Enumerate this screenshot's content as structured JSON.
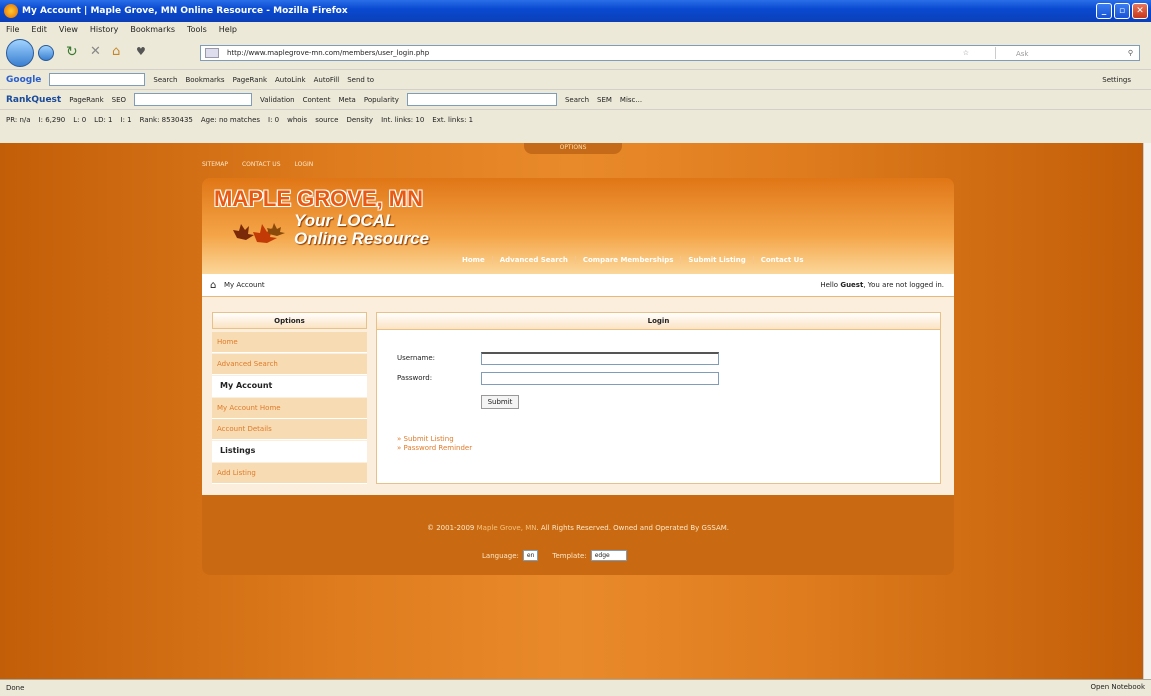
{
  "window": {
    "title": "My Account | Maple Grove, MN Online Resource - Mozilla Firefox"
  },
  "menu": [
    "File",
    "Edit",
    "View",
    "History",
    "Bookmarks",
    "Tools",
    "Help"
  ],
  "address": {
    "url": "http://www.maplegrove-mn.com/members/user_login.php"
  },
  "search": {
    "placeholder": "Ask"
  },
  "toolbars": {
    "google": {
      "logo": "Google",
      "items": [
        "Search",
        "Bookmarks",
        "PageRank",
        "AutoLink",
        "AutoFill",
        "Send to"
      ],
      "settings": "Settings"
    },
    "rankquest": {
      "logo": "RankQuest",
      "items": [
        "PageRank",
        "SEO",
        "Validation",
        "Content",
        "Meta",
        "Popularity",
        "Search",
        "SEM",
        "Misc..."
      ]
    },
    "seo": {
      "items": [
        "PR: n/a",
        "I: 6,290",
        "L: 0",
        "LD: 1",
        "I: 1",
        "Rank: 8530435",
        "Age: no matches",
        "I: 0",
        "whois",
        "source",
        "Density",
        "Int. links: 10",
        "Ext. links: 1"
      ]
    }
  },
  "options_tab": "OPTIONS",
  "site": {
    "top_links": [
      "SITEMAP",
      "CONTACT US",
      "LOGIN"
    ],
    "logo_title": "MAPLE GROVE, MN",
    "logo_line1": "Your LOCAL",
    "logo_line2": "Online Resource",
    "nav": [
      "Home",
      "Advanced Search",
      "Compare Memberships",
      "Submit Listing",
      "Contact Us"
    ],
    "breadcrumb": "My Account",
    "greeting_prefix": "Hello",
    "greeting_name": "Guest",
    "greeting_suffix": ", You are not logged in.",
    "sidebar": {
      "title": "Options",
      "items": [
        "Home",
        "Advanced Search",
        "My Account",
        "My Account Home",
        "Account Details",
        "Listings",
        "Add Listing"
      ]
    },
    "login": {
      "title": "Login",
      "username_label": "Username:",
      "password_label": "Password:",
      "username_value": "",
      "password_value": "",
      "submit": "Submit",
      "links": [
        "Submit Listing",
        "Password Reminder"
      ]
    },
    "footer": {
      "copy_prefix": "© 2001-2009",
      "site": "Maple Grove, MN",
      "copy_suffix": ". All Rights Reserved. Owned and Operated By GSSAM.",
      "language_label": "Language:",
      "language_value": "en",
      "template_label": "Template:",
      "template_value": "edge"
    }
  },
  "status": {
    "text": "Done",
    "open_notebook": "Open Notebook"
  },
  "colors": {
    "accent": "#e07a2a",
    "header_orange": "#e85a12",
    "footer": "#c96a12"
  }
}
